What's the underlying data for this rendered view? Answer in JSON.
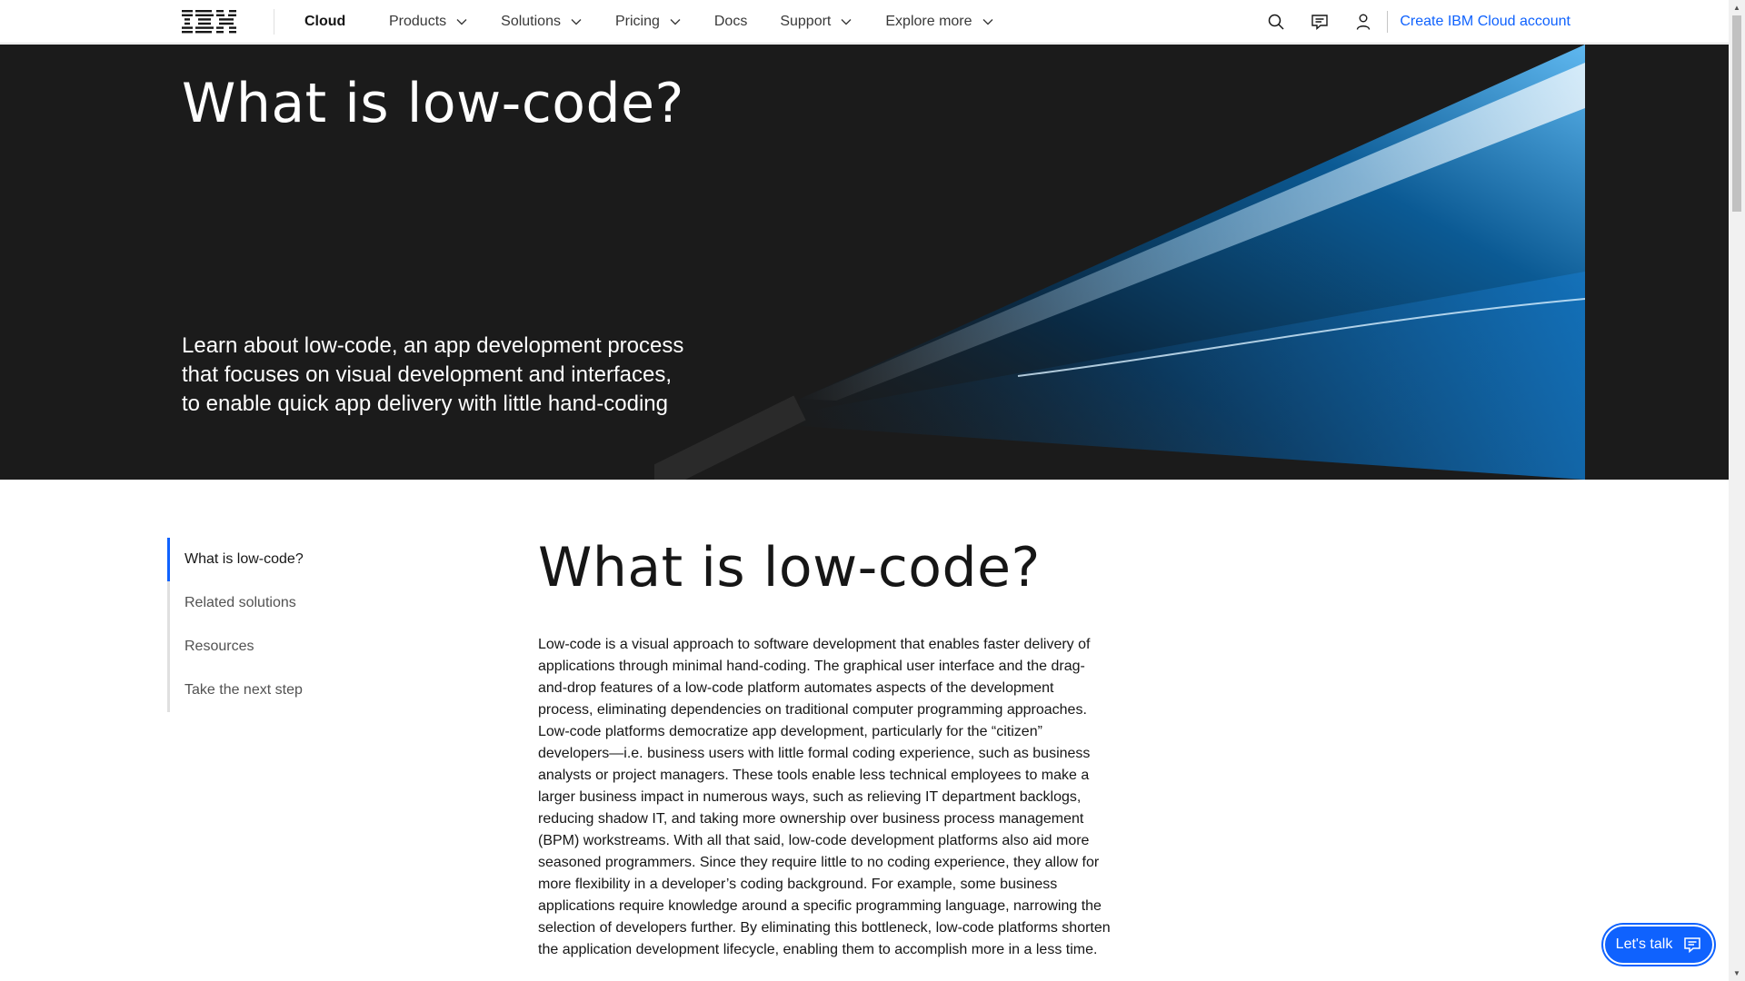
{
  "nav": {
    "logo_text": "IBM",
    "brand": "Cloud",
    "items": [
      {
        "label": "Products",
        "has_menu": true
      },
      {
        "label": "Solutions",
        "has_menu": true
      },
      {
        "label": "Pricing",
        "has_menu": true
      },
      {
        "label": "Docs",
        "has_menu": false
      },
      {
        "label": "Support",
        "has_menu": true
      },
      {
        "label": "Explore more",
        "has_menu": true
      }
    ],
    "icons": [
      "search-icon",
      "chat-icon",
      "user-icon"
    ],
    "create_account": "Create IBM Cloud account"
  },
  "hero": {
    "title": "What is low-code?",
    "lead": "Learn about low-code, an app development process that focuses on visual development and interfaces, to enable quick app delivery with little hand-coding"
  },
  "sidenav": {
    "items": [
      {
        "label": "What is low-code?",
        "active": true
      },
      {
        "label": "Related solutions",
        "active": false
      },
      {
        "label": "Resources",
        "active": false
      },
      {
        "label": "Take the next step",
        "active": false
      }
    ]
  },
  "article": {
    "heading": "What is low-code?",
    "body": "Low-code is a visual approach to software development that enables faster delivery of applications through minimal hand-coding. The graphical user interface and the drag-and-drop features of a low-code platform automates aspects of the development process, eliminating dependencies on traditional computer programming approaches. Low-code platforms democratize app development, particularly for the “citizen” developers—i.e. business users with little formal coding experience, such as business analysts or project managers. These tools enable less technical employees to make a larger business impact in numerous ways, such as relieving IT department backlogs, reducing shadow IT, and taking more ownership over business process management (BPM) workstreams. With all that said, low-code development platforms also aid more seasoned programmers. Since they require little to no coding experience, they allow for more flexibility in a developer’s coding background. For example, some business applications require knowledge around a specific programming language, narrowing the selection of developers further. By eliminating this bottleneck, low-code platforms shorten the application development lifecycle, enabling them to accomplish more in a less time."
  },
  "chat": {
    "label": "Let's talk"
  },
  "colors": {
    "accent": "#0f62fe",
    "hero_bg": "#1b1b1b",
    "text": "#161616"
  }
}
